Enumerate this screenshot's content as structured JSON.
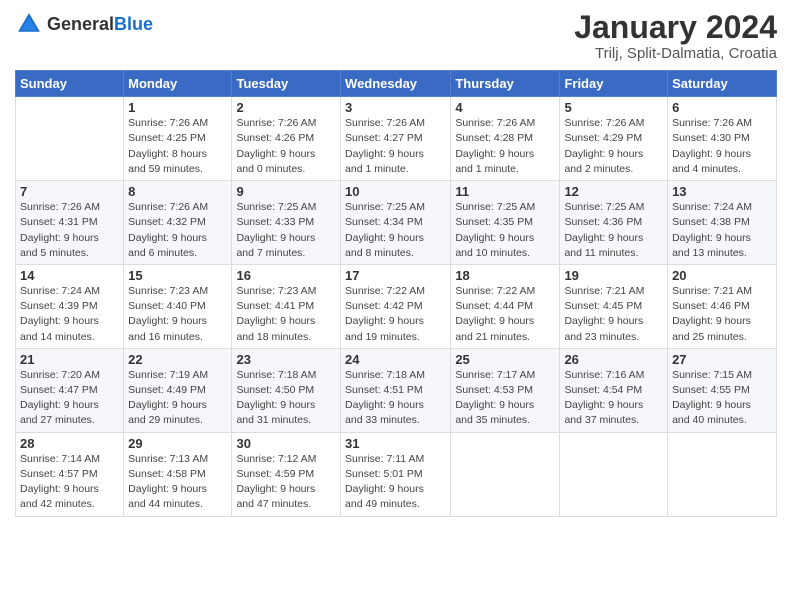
{
  "header": {
    "logo_general": "General",
    "logo_blue": "Blue",
    "month_year": "January 2024",
    "location": "Trilj, Split-Dalmatia, Croatia"
  },
  "weekdays": [
    "Sunday",
    "Monday",
    "Tuesday",
    "Wednesday",
    "Thursday",
    "Friday",
    "Saturday"
  ],
  "weeks": [
    [
      {
        "day": "",
        "info": ""
      },
      {
        "day": "1",
        "info": "Sunrise: 7:26 AM\nSunset: 4:25 PM\nDaylight: 8 hours\nand 59 minutes."
      },
      {
        "day": "2",
        "info": "Sunrise: 7:26 AM\nSunset: 4:26 PM\nDaylight: 9 hours\nand 0 minutes."
      },
      {
        "day": "3",
        "info": "Sunrise: 7:26 AM\nSunset: 4:27 PM\nDaylight: 9 hours\nand 1 minute."
      },
      {
        "day": "4",
        "info": "Sunrise: 7:26 AM\nSunset: 4:28 PM\nDaylight: 9 hours\nand 1 minute."
      },
      {
        "day": "5",
        "info": "Sunrise: 7:26 AM\nSunset: 4:29 PM\nDaylight: 9 hours\nand 2 minutes."
      },
      {
        "day": "6",
        "info": "Sunrise: 7:26 AM\nSunset: 4:30 PM\nDaylight: 9 hours\nand 4 minutes."
      }
    ],
    [
      {
        "day": "7",
        "info": "Sunrise: 7:26 AM\nSunset: 4:31 PM\nDaylight: 9 hours\nand 5 minutes."
      },
      {
        "day": "8",
        "info": "Sunrise: 7:26 AM\nSunset: 4:32 PM\nDaylight: 9 hours\nand 6 minutes."
      },
      {
        "day": "9",
        "info": "Sunrise: 7:25 AM\nSunset: 4:33 PM\nDaylight: 9 hours\nand 7 minutes."
      },
      {
        "day": "10",
        "info": "Sunrise: 7:25 AM\nSunset: 4:34 PM\nDaylight: 9 hours\nand 8 minutes."
      },
      {
        "day": "11",
        "info": "Sunrise: 7:25 AM\nSunset: 4:35 PM\nDaylight: 9 hours\nand 10 minutes."
      },
      {
        "day": "12",
        "info": "Sunrise: 7:25 AM\nSunset: 4:36 PM\nDaylight: 9 hours\nand 11 minutes."
      },
      {
        "day": "13",
        "info": "Sunrise: 7:24 AM\nSunset: 4:38 PM\nDaylight: 9 hours\nand 13 minutes."
      }
    ],
    [
      {
        "day": "14",
        "info": "Sunrise: 7:24 AM\nSunset: 4:39 PM\nDaylight: 9 hours\nand 14 minutes."
      },
      {
        "day": "15",
        "info": "Sunrise: 7:23 AM\nSunset: 4:40 PM\nDaylight: 9 hours\nand 16 minutes."
      },
      {
        "day": "16",
        "info": "Sunrise: 7:23 AM\nSunset: 4:41 PM\nDaylight: 9 hours\nand 18 minutes."
      },
      {
        "day": "17",
        "info": "Sunrise: 7:22 AM\nSunset: 4:42 PM\nDaylight: 9 hours\nand 19 minutes."
      },
      {
        "day": "18",
        "info": "Sunrise: 7:22 AM\nSunset: 4:44 PM\nDaylight: 9 hours\nand 21 minutes."
      },
      {
        "day": "19",
        "info": "Sunrise: 7:21 AM\nSunset: 4:45 PM\nDaylight: 9 hours\nand 23 minutes."
      },
      {
        "day": "20",
        "info": "Sunrise: 7:21 AM\nSunset: 4:46 PM\nDaylight: 9 hours\nand 25 minutes."
      }
    ],
    [
      {
        "day": "21",
        "info": "Sunrise: 7:20 AM\nSunset: 4:47 PM\nDaylight: 9 hours\nand 27 minutes."
      },
      {
        "day": "22",
        "info": "Sunrise: 7:19 AM\nSunset: 4:49 PM\nDaylight: 9 hours\nand 29 minutes."
      },
      {
        "day": "23",
        "info": "Sunrise: 7:18 AM\nSunset: 4:50 PM\nDaylight: 9 hours\nand 31 minutes."
      },
      {
        "day": "24",
        "info": "Sunrise: 7:18 AM\nSunset: 4:51 PM\nDaylight: 9 hours\nand 33 minutes."
      },
      {
        "day": "25",
        "info": "Sunrise: 7:17 AM\nSunset: 4:53 PM\nDaylight: 9 hours\nand 35 minutes."
      },
      {
        "day": "26",
        "info": "Sunrise: 7:16 AM\nSunset: 4:54 PM\nDaylight: 9 hours\nand 37 minutes."
      },
      {
        "day": "27",
        "info": "Sunrise: 7:15 AM\nSunset: 4:55 PM\nDaylight: 9 hours\nand 40 minutes."
      }
    ],
    [
      {
        "day": "28",
        "info": "Sunrise: 7:14 AM\nSunset: 4:57 PM\nDaylight: 9 hours\nand 42 minutes."
      },
      {
        "day": "29",
        "info": "Sunrise: 7:13 AM\nSunset: 4:58 PM\nDaylight: 9 hours\nand 44 minutes."
      },
      {
        "day": "30",
        "info": "Sunrise: 7:12 AM\nSunset: 4:59 PM\nDaylight: 9 hours\nand 47 minutes."
      },
      {
        "day": "31",
        "info": "Sunrise: 7:11 AM\nSunset: 5:01 PM\nDaylight: 9 hours\nand 49 minutes."
      },
      {
        "day": "",
        "info": ""
      },
      {
        "day": "",
        "info": ""
      },
      {
        "day": "",
        "info": ""
      }
    ]
  ]
}
